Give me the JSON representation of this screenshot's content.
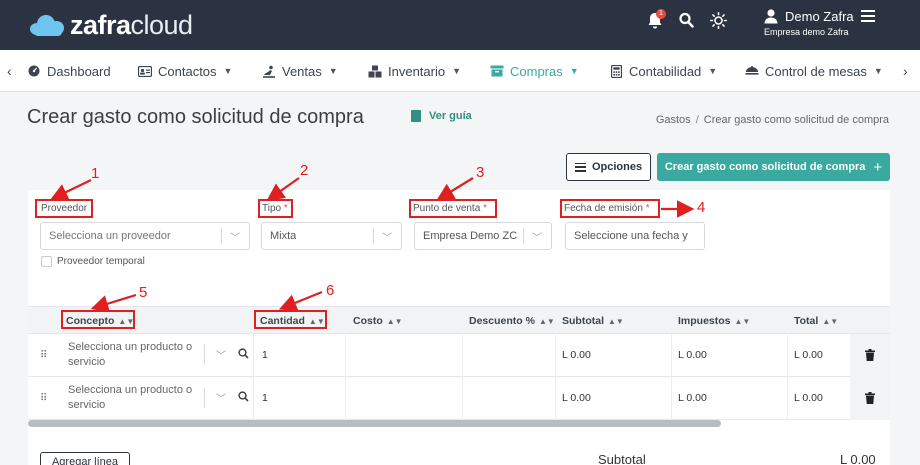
{
  "brand": {
    "logo_bold": "zafra",
    "logo_light": "cloud"
  },
  "topbar": {
    "notification_count": "1",
    "user_name": "Demo Zafra",
    "company": "Empresa demo Zafra"
  },
  "nav": {
    "items": [
      {
        "label": "Dashboard",
        "icon": "dashboard-icon"
      },
      {
        "label": "Contactos",
        "icon": "contacts-icon"
      },
      {
        "label": "Ventas",
        "icon": "sales-icon"
      },
      {
        "label": "Inventario",
        "icon": "inventory-icon"
      },
      {
        "label": "Compras",
        "icon": "cart-icon",
        "active": true
      },
      {
        "label": "Contabilidad",
        "icon": "calculator-icon"
      },
      {
        "label": "Control de mesas",
        "icon": "tables-icon"
      }
    ]
  },
  "page": {
    "title": "Crear gasto como solicitud de compra",
    "guide_label": "Ver guía",
    "breadcrumb": [
      "Gastos",
      "Crear gasto como solicitud de compra"
    ],
    "breadcrumb_sep": "/"
  },
  "actions": {
    "options_label": "Opciones",
    "create_label": "Crear gasto como solicitud de compra",
    "create_icon": "+"
  },
  "form": {
    "required_mark": "*",
    "provider": {
      "label": "Proveedor",
      "placeholder": "Selecciona un proveedor"
    },
    "type": {
      "label": "Tipo",
      "value": "Mixta"
    },
    "pos": {
      "label": "Punto de venta",
      "value": "Empresa Demo ZC"
    },
    "issue_date": {
      "label": "Fecha de emisión",
      "placeholder": "Seleccione una fecha y"
    },
    "temp_provider_label": "Proveedor temporal"
  },
  "table": {
    "headers": [
      "Concepto",
      "Cantidad",
      "Costo",
      "Descuento %",
      "Subtotal",
      "Impuestos",
      "Total"
    ],
    "rows": [
      {
        "concept_placeholder": "Selecciona un producto o servicio",
        "quantity": "1",
        "subtotal": "L 0.00",
        "taxes": "L 0.00",
        "total": "L 0.00"
      },
      {
        "concept_placeholder": "Selecciona un producto o servicio",
        "quantity": "1",
        "subtotal": "L 0.00",
        "taxes": "L 0.00",
        "total": "L 0.00"
      }
    ]
  },
  "footer": {
    "add_line_label": "Agregar línea",
    "subtotal_label": "Subtotal",
    "subtotal_value": "L 0.00"
  },
  "annotations": [
    "1",
    "2",
    "3",
    "4",
    "5",
    "6"
  ],
  "colors": {
    "accent": "#3aa99f",
    "header_bg": "#2b3342",
    "annotation": "#e02020"
  }
}
